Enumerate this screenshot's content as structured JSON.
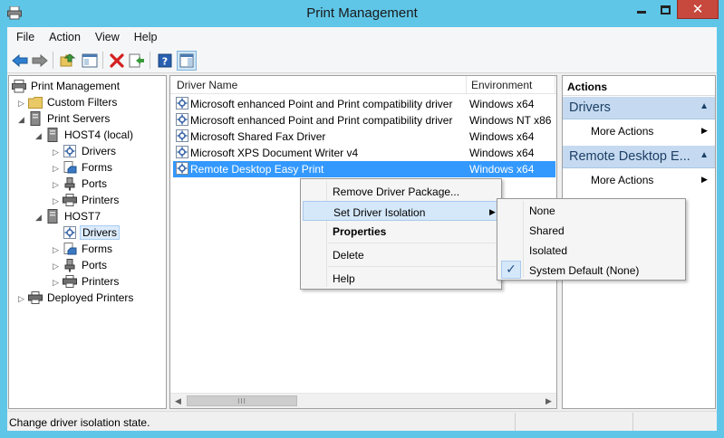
{
  "window": {
    "title": "Print Management"
  },
  "menubar": [
    "File",
    "Action",
    "View",
    "Help"
  ],
  "tree": {
    "root": "Print Management",
    "custom_filters": "Custom Filters",
    "print_servers": "Print Servers",
    "host4": "HOST4 (local)",
    "host4_children": [
      "Drivers",
      "Forms",
      "Ports",
      "Printers"
    ],
    "host7": "HOST7",
    "host7_children": [
      "Drivers",
      "Forms",
      "Ports",
      "Printers"
    ],
    "deployed_printers": "Deployed Printers"
  },
  "list": {
    "columns": [
      "Driver Name",
      "Environment"
    ],
    "rows": [
      {
        "name": "Microsoft enhanced Point and Print compatibility driver",
        "env": "Windows x64"
      },
      {
        "name": "Microsoft enhanced Point and Print compatibility driver",
        "env": "Windows NT x86"
      },
      {
        "name": "Microsoft Shared Fax Driver",
        "env": "Windows x64"
      },
      {
        "name": "Microsoft XPS Document Writer v4",
        "env": "Windows x64"
      },
      {
        "name": "Remote Desktop Easy Print",
        "env": "Windows x64"
      }
    ],
    "selected_index": 4
  },
  "actions": {
    "title": "Actions",
    "sections": [
      {
        "label": "Drivers",
        "item": "More Actions"
      },
      {
        "label": "Remote Desktop E...",
        "item": "More Actions"
      }
    ]
  },
  "context_menu": {
    "items": [
      "Remove Driver Package...",
      "Set Driver Isolation",
      "Properties",
      "Delete",
      "Help"
    ],
    "submenu": [
      "None",
      "Shared",
      "Isolated",
      "System Default (None)"
    ],
    "submenu_checked": "System Default (None)"
  },
  "status": {
    "text": "Change driver isolation state."
  },
  "colors": {
    "titlebar": "#5fc6e8",
    "selection": "#3399ff",
    "close_button": "#c7483c",
    "action_header": "#c5daf0"
  }
}
